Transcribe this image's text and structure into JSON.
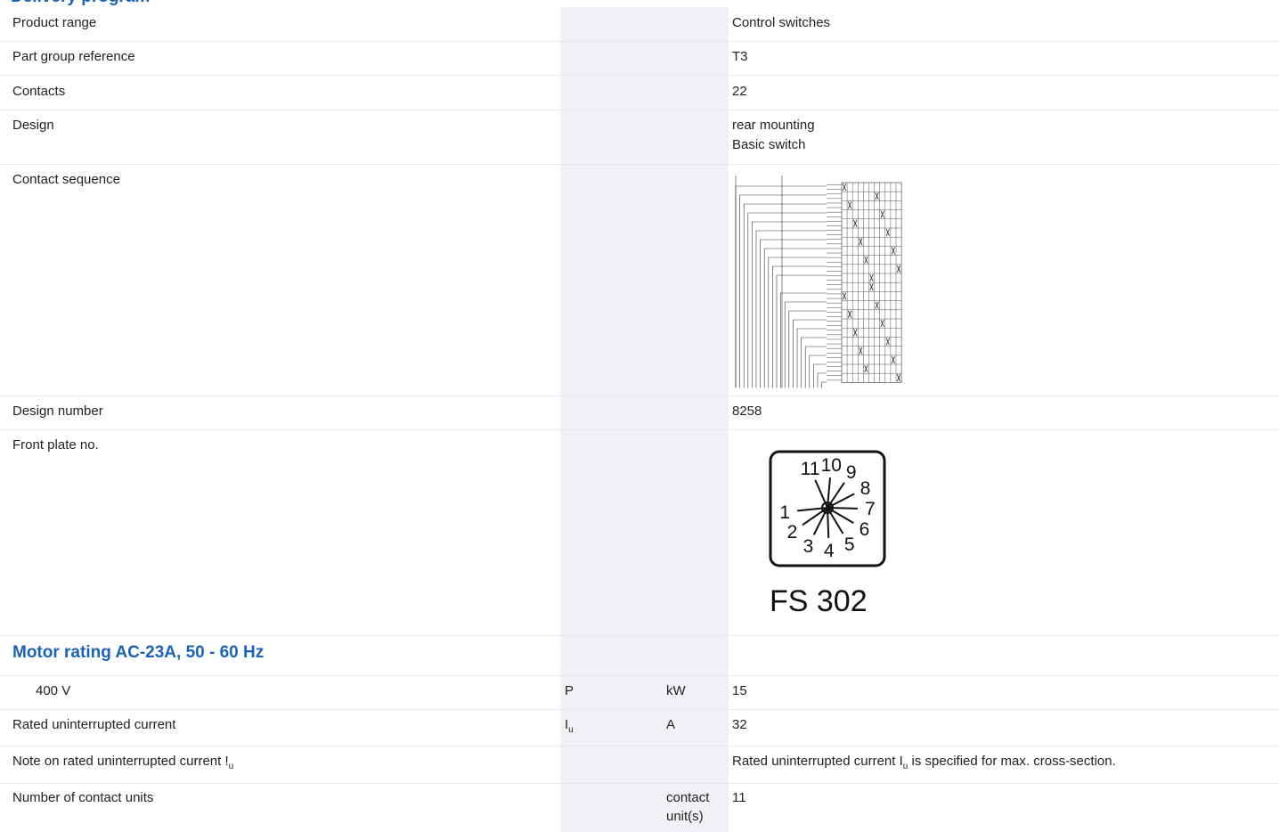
{
  "top_heading": "Delivery program",
  "rows": {
    "product_range": {
      "label": "Product range",
      "value": "Control switches"
    },
    "part_group": {
      "label": "Part group reference",
      "value": "T3"
    },
    "contacts": {
      "label": "Contacts",
      "value": "22"
    },
    "design": {
      "label": "Design",
      "value_line1": "rear mounting",
      "value_line2": "Basic switch"
    },
    "contact_sequence": {
      "label": "Contact sequence"
    },
    "design_number": {
      "label": "Design number",
      "value": "8258"
    },
    "front_plate": {
      "label": "Front plate no.",
      "caption": "FS 302",
      "numbers": [
        "1",
        "2",
        "3",
        "4",
        "5",
        "6",
        "7",
        "8",
        "9",
        "10",
        "11"
      ]
    }
  },
  "section": {
    "title": "Motor rating AC-23A, 50 - 60 Hz"
  },
  "rating_rows": {
    "v400": {
      "label": "400 V",
      "symbol": "P",
      "unit": "kW",
      "value": "15"
    },
    "iu": {
      "label": "Rated uninterrupted current",
      "symbol": "I",
      "symbol_sub": "u",
      "unit": "A",
      "value": "32"
    },
    "note": {
      "label": "Note on rated uninterrupted current !",
      "label_sub": "u",
      "value_pre": "Rated uninterrupted current I",
      "value_sub": "u",
      "value_post": " is specified for max. cross-section."
    },
    "contact_units": {
      "label": "Number of contact units",
      "unit_line1": "contact",
      "unit_line2": "unit(s)",
      "value": "11"
    }
  }
}
